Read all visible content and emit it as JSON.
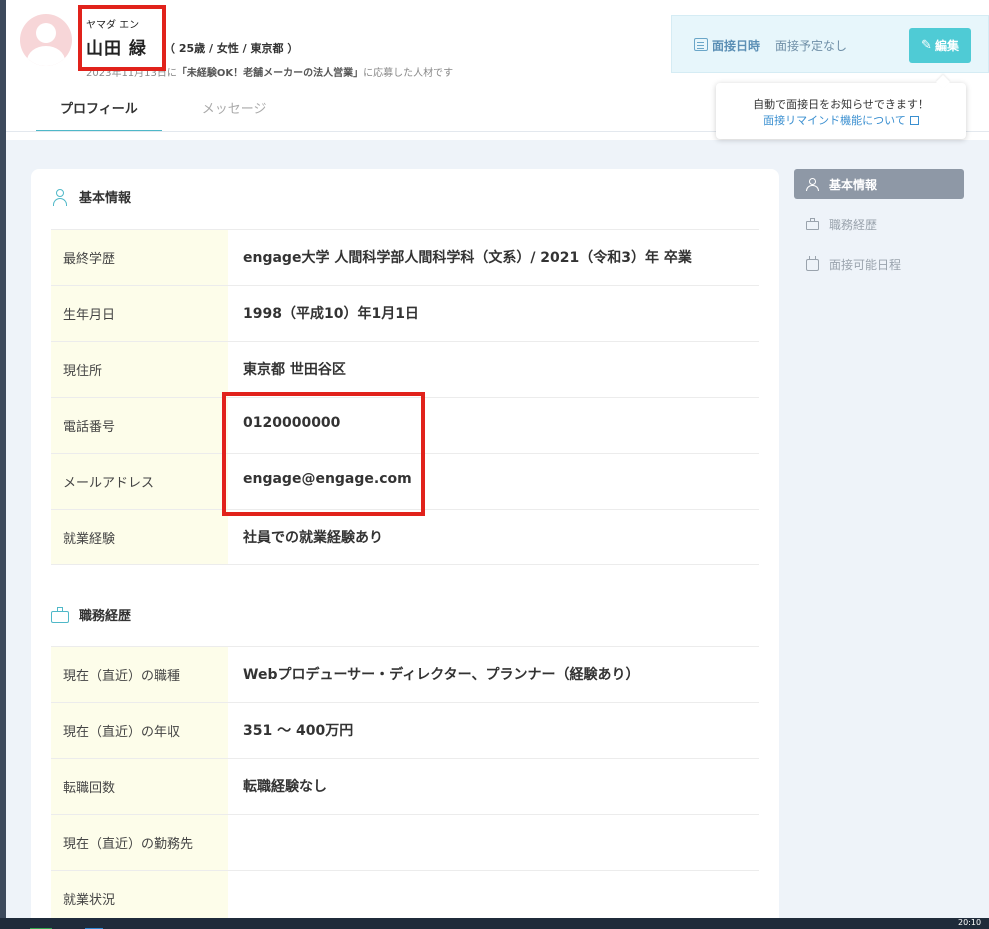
{
  "candidate": {
    "kana": "ヤマダ エン",
    "name": "山田 緑",
    "meta": "（ 25歳 / 女性 / 東京都 ）",
    "applied_prefix": "2023年11月13日に",
    "applied_job": "「未経験OK！老舗メーカーの法人営業」",
    "applied_suffix": "に応募した人材です"
  },
  "tabs": [
    {
      "label": "プロフィール",
      "active": true
    },
    {
      "label": "メッセージ",
      "active": false
    }
  ],
  "interview": {
    "label": "面接日時",
    "value": "面接予定なし",
    "edit_label": "編集"
  },
  "tooltip": {
    "line1": "自動で面接日をお知らせできます！",
    "link": "面接リマインド機能について"
  },
  "sections": [
    {
      "title": "基本情報",
      "icon": "person-icon",
      "rows": [
        {
          "label": "最終学歴",
          "value": "engage大学 人間科学部人間科学科（文系）/ 2021（令和3）年 卒業"
        },
        {
          "label": "生年月日",
          "value": "1998（平成10）年1月1日"
        },
        {
          "label": "現住所",
          "value": "東京都 世田谷区"
        },
        {
          "label": "電話番号",
          "value": "0120000000"
        },
        {
          "label": "メールアドレス",
          "value": "engage@engage.com"
        },
        {
          "label": "就業経験",
          "value": "社員での就業経験あり"
        }
      ]
    },
    {
      "title": "職務経歴",
      "icon": "briefcase-icon",
      "rows": [
        {
          "label": "現在（直近）の職種",
          "value": "Webプロデューサー・ディレクター、プランナー（経験あり）"
        },
        {
          "label": "現在（直近）の年収",
          "value": "351 〜 400万円"
        },
        {
          "label": "転職回数",
          "value": "転職経験なし"
        },
        {
          "label": "現在（直近）の勤務先",
          "value": ""
        },
        {
          "label": "就業状況",
          "value": ""
        }
      ]
    }
  ],
  "side_nav": [
    {
      "label": "基本情報",
      "icon": "person-icon",
      "active": true
    },
    {
      "label": "職務経歴",
      "icon": "briefcase-icon",
      "active": false
    },
    {
      "label": "面接可能日程",
      "icon": "calendar-icon",
      "active": false
    }
  ],
  "taskbar": {
    "clock": "20:10"
  },
  "colors": {
    "accent": "#4fcbd5",
    "highlight_box": "#e1221b",
    "label_bg": "#fdfdea"
  }
}
